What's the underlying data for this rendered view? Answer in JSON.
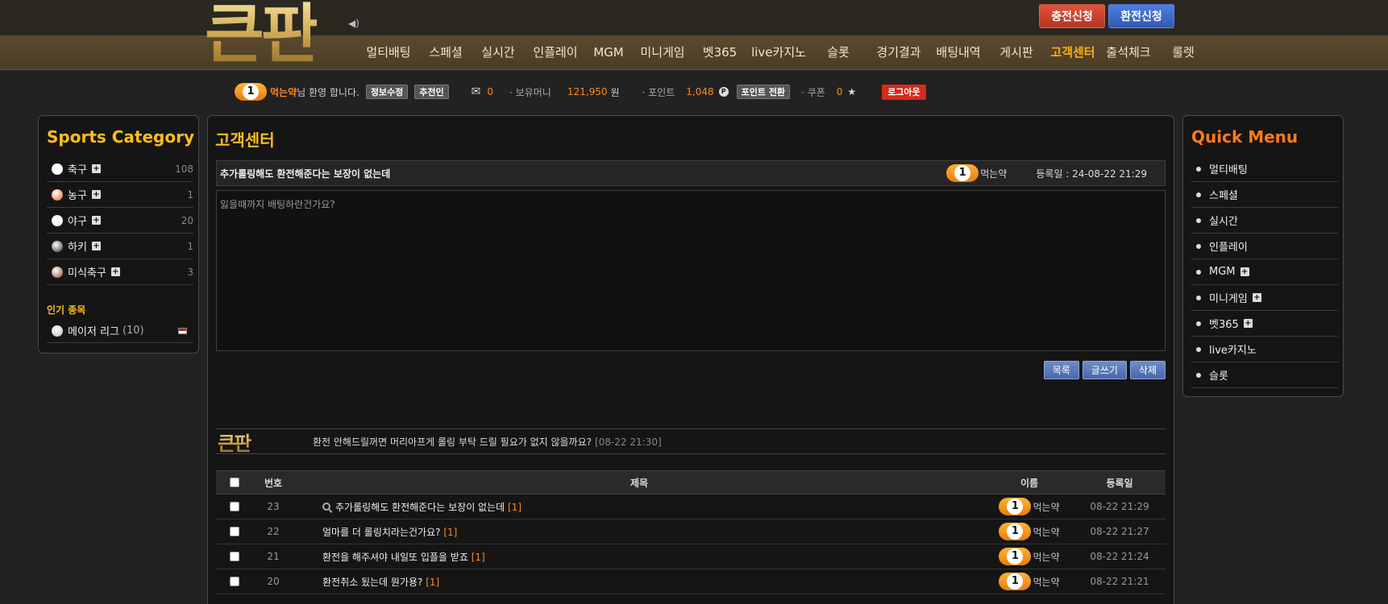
{
  "header": {
    "logo": "큰판",
    "charge_btn": "충전신청",
    "exchange_btn": "환전신청",
    "nav": [
      "멀티배팅",
      "스페셜",
      "실시간",
      "인플레이",
      "MGM",
      "미니게임",
      "벳365",
      "live카지노",
      "슬롯",
      "경기결과",
      "배팅내역",
      "게시판",
      "고객센터",
      "출석체크",
      "룰렛"
    ],
    "active_nav": "고객센터"
  },
  "member": {
    "level": "1",
    "name": "먹는약",
    "welcome": "님 환영 합니다.",
    "edit_btn": "정보수정",
    "referral_btn": "추천인",
    "messages": "0",
    "money_label": "· 보유머니",
    "money": "121,950",
    "money_unit": "원",
    "point_label": "· 포인트",
    "point": "1,048",
    "point_icon": "P",
    "point_btn": "포인트 전환",
    "coupon_label": "· 쿠폰",
    "coupon": "0",
    "logout_btn": "로그아웃"
  },
  "sports": {
    "title": "Sports Category",
    "items": [
      {
        "name": "축구",
        "count": "108",
        "color": "#ffffff"
      },
      {
        "name": "농구",
        "count": "1",
        "color": "#e2621a"
      },
      {
        "name": "야구",
        "count": "20",
        "color": "#f0f0f0"
      },
      {
        "name": "하키",
        "count": "1",
        "color": "#333333"
      },
      {
        "name": "미식축구",
        "count": "3",
        "color": "#8a4a22"
      }
    ],
    "popular_label": "인기 종목",
    "popular_item": "메이저 리그",
    "popular_count": "(10)"
  },
  "quick": {
    "title": "Quick Menu",
    "items": [
      "멀티배팅",
      "스페셜",
      "실시간",
      "인플레이",
      "MGM",
      "미니게임",
      "벳365",
      "live카지노",
      "슬롯"
    ]
  },
  "post": {
    "section_title": "고객센터",
    "title": "추가롤링해도 환전해준다는 보장이 없는데",
    "author": "먹는약",
    "date": "등록일 : 24-08-22 21:29",
    "body": "잃을때까지 배팅하란건가요?",
    "list_btn": "목록",
    "write_btn": "글쓰기",
    "delete_btn": "삭제"
  },
  "reply": {
    "logo": "큰판",
    "text": "환전 안해드릴꺼면 머리아프게 롤링 부탁 드릴 필요가 없지 않을까요?",
    "time": "[08-22 21:30]"
  },
  "table": {
    "headers": {
      "no": "번호",
      "title": "제목",
      "name": "이름",
      "date": "등록일"
    },
    "rows": [
      {
        "no": "23",
        "title": "추가롤링해도 환전해준다는 보장이 없는데",
        "comments": "[1]",
        "name": "먹는약",
        "date": "08-22 21:29"
      },
      {
        "no": "22",
        "title": "얼마를 더 롤링치라는건가요?",
        "comments": "[1]",
        "name": "먹는약",
        "date": "08-22 21:27"
      },
      {
        "no": "21",
        "title": "환전을 해주셔야 내일또 입플을 받죠",
        "comments": "[1]",
        "name": "먹는약",
        "date": "08-22 21:24"
      },
      {
        "no": "20",
        "title": "환전취소 됬는데 뭔가용?",
        "comments": "[1]",
        "name": "먹는약",
        "date": "08-22 21:21"
      }
    ]
  }
}
